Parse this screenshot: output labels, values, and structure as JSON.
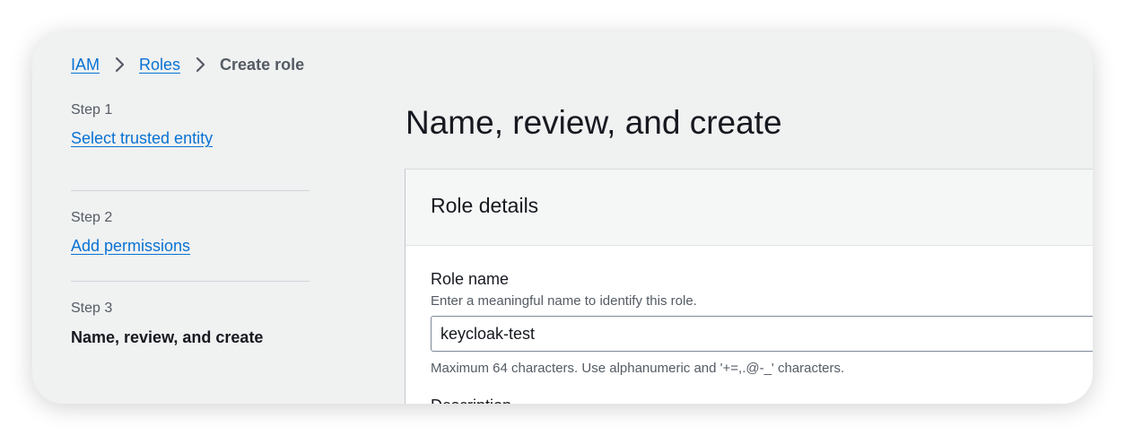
{
  "breadcrumb": {
    "items": [
      "IAM",
      "Roles"
    ],
    "current": "Create role"
  },
  "steps": [
    {
      "label": "Step 1",
      "title": "Select trusted entity"
    },
    {
      "label": "Step 2",
      "title": "Add permissions"
    },
    {
      "label": "Step 3",
      "title": "Name, review, and create"
    }
  ],
  "page": {
    "title": "Name, review, and create"
  },
  "role_details": {
    "title": "Role details",
    "role_name": {
      "label": "Role name",
      "description": "Enter a meaningful name to identify this role.",
      "value": "keycloak-test",
      "constraint": "Maximum 64 characters. Use alphanumeric and '+=,.@-_' characters."
    },
    "description_label": "Description"
  },
  "colors": {
    "link": "#0972d3",
    "background": "#f0f1f1"
  }
}
